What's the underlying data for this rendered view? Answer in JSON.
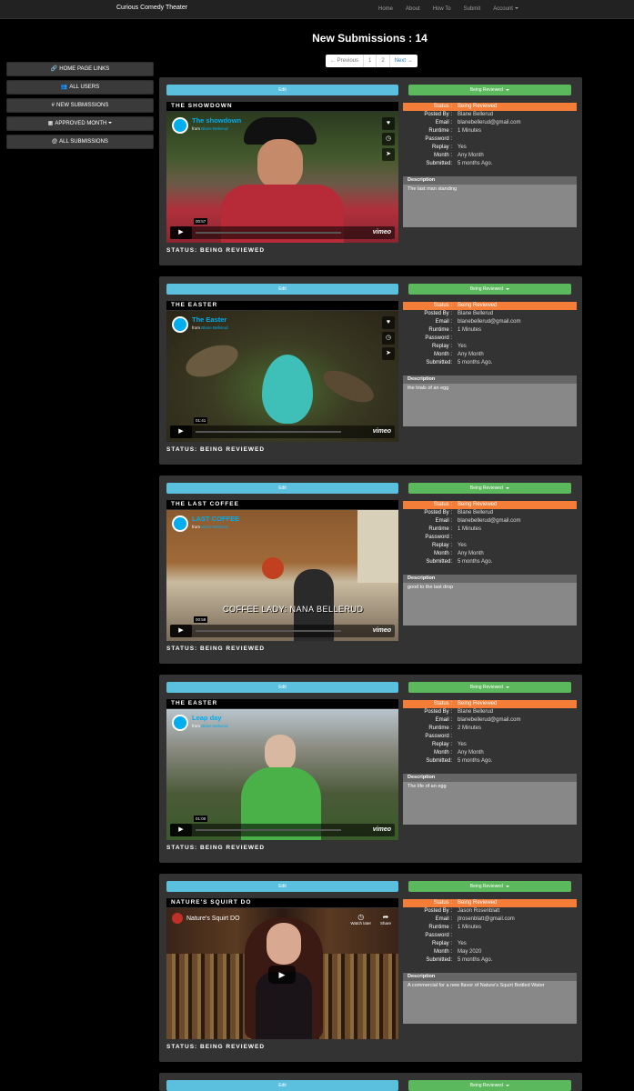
{
  "navbar": {
    "brand": "Curious Comedy Theater",
    "links": [
      "Home",
      "About",
      "How To",
      "Submit"
    ],
    "account": "Account"
  },
  "page_title": "New Submissions : 14",
  "pager": {
    "previous": "← Previous",
    "p1": "1",
    "p2": "2",
    "next": "Next →"
  },
  "sidebar": [
    {
      "icon": "link-icon",
      "glyph": "🔗",
      "label": "HOME PAGE LINKS"
    },
    {
      "icon": "users-icon",
      "glyph": "👥",
      "label": "ALL USERS"
    },
    {
      "icon": "hash-icon",
      "glyph": "#",
      "label": "NEW SUBMISSIONS"
    },
    {
      "icon": "calendar-icon",
      "glyph": "▦",
      "label": "APPROVED MONTH"
    },
    {
      "icon": "at-icon",
      "glyph": "@",
      "label": "ALL SUBMISSIONS"
    }
  ],
  "labels": {
    "edit": "Edit",
    "being_reviewed": "Being Reviewed",
    "status": "Status :",
    "posted_by": "Posted By :",
    "email": "Email :",
    "runtime": "Runtime :",
    "password": "Password :",
    "replay": "Replay :",
    "month": "Month :",
    "submitted": "Submitted:",
    "description": "Description",
    "status_footer": "STATUS: BEING REVIEWED",
    "from": "from"
  },
  "submissions": [
    {
      "title": "THE SHOWDOWN",
      "video_name": "The showdown",
      "author": "Blane Bellerud",
      "time": "00:57",
      "status": "Being Reviewed",
      "posted_by": "Blane Bellerud",
      "email": "blanebellerud@gmail.com",
      "runtime": "1 Minutes",
      "password": "",
      "replay": "Yes",
      "month": "Any Month",
      "submitted": "5 months Ago.",
      "description": "The last man standing"
    },
    {
      "title": "THE EASTER",
      "video_name": "The Easter",
      "author": "Blane Bellerud",
      "time": "01:41",
      "status": "Being Reviewed",
      "posted_by": "Blane Bellerud",
      "email": "blanebellerud@gmail.com",
      "runtime": "1 Minutes",
      "password": "",
      "replay": "Yes",
      "month": "Any Month",
      "submitted": "5 months Ago.",
      "description": "the trials of an egg"
    },
    {
      "title": "THE LAST COFFEE",
      "video_name": "LAST COFFEE",
      "author": "Blane Bellerud",
      "time": "00:59",
      "overlay": "COFFEE LADY: NANA BELLERUD",
      "status": "Being Reviewed",
      "posted_by": "Blane Bellerud",
      "email": "blanebellerud@gmail.com",
      "runtime": "1 Minutes",
      "password": "",
      "replay": "Yes",
      "month": "Any Month",
      "submitted": "5 months Ago.",
      "description": "good to the last drop"
    },
    {
      "title": "THE EASTER",
      "video_name": "Leap day",
      "author": "Blane Bellerud",
      "time": "01:00",
      "status": "Being Reviewed",
      "posted_by": "Blane Bellerud",
      "email": "blanebellerud@gmail.com",
      "runtime": "2 Minutes",
      "password": "",
      "replay": "Yes",
      "month": "Any Month",
      "submitted": "5 months Ago.",
      "description": "The life of an egg"
    },
    {
      "title": "NATURE'S SQUIRT DO",
      "video_name": "Nature's Squirt DO",
      "watch_later": "Watch later",
      "share": "Share",
      "status": "Being Reviewed",
      "posted_by": "Jason Rosenblatt",
      "email": "jtrosenblatt@gmail.com",
      "runtime": "1 Minutes",
      "password": "",
      "replay": "Yes",
      "month": "May 2020",
      "submitted": "5 months Ago.",
      "description": "A commercial for a new flavor of Nature's Squirt Bottled Water"
    }
  ],
  "colors": {
    "edit": "#5bc0de",
    "status_button": "#5cb85c",
    "status_row": "#f47d38",
    "vimeo_blue": "#00adef"
  }
}
